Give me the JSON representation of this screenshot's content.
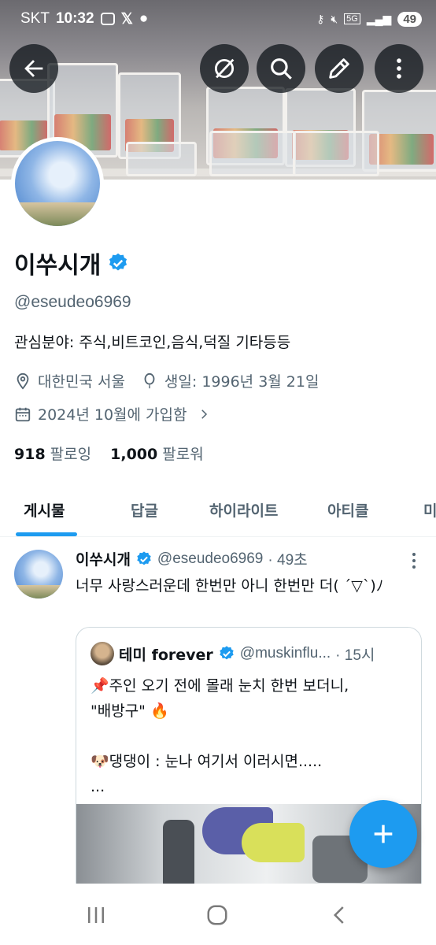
{
  "status_bar": {
    "carrier": "SKT",
    "time": "10:32",
    "battery": "49",
    "network": "5G"
  },
  "header": {
    "back_icon": "arrow-left-icon",
    "grok_icon": "grok-icon",
    "search_icon": "search-icon",
    "edit_icon": "edit-icon",
    "more_icon": "more-vertical-icon"
  },
  "profile": {
    "display_name": "이쑤시개",
    "handle": "@eseudeo6969",
    "bio": "관심분야: 주식,비트코인,음식,덕질 기타등등",
    "location": "대한민국 서울",
    "birthday": "생일: 1996년 3월 21일",
    "joined": "2024년 10월에 가입함",
    "following_count": "918",
    "following_label": "팔로잉",
    "followers_count": "1,000",
    "followers_label": "팔로워"
  },
  "tabs": [
    {
      "label": "게시물",
      "active": true
    },
    {
      "label": "답글",
      "active": false
    },
    {
      "label": "하이라이트",
      "active": false
    },
    {
      "label": "아티클",
      "active": false
    },
    {
      "label": "미",
      "active": false
    }
  ],
  "tweet": {
    "name": "이쑤시개",
    "handle": "@eseudeo6969",
    "time": "· 49초",
    "text": "너무 사랑스러운데 한번만 아니 한번만 더( ´▽`)ﾉ",
    "quote": {
      "name": "테미 forever",
      "handle": "@muskinflu...",
      "time": "· 15시",
      "text": "📌주인 오기 전에 몰래 눈치 한번 보더니,\n\"배방구\" 🔥\n\n🐶댕댕이 : 눈나 여기서 이러시면.....\n..."
    }
  },
  "colors": {
    "accent": "#1d9bf0",
    "text": "#0f1419",
    "secondary": "#536471"
  }
}
